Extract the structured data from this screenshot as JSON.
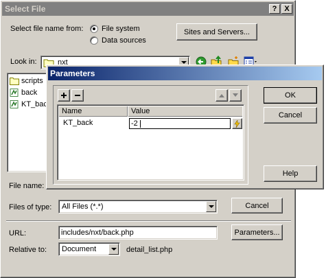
{
  "select_dialog": {
    "title": "Select File",
    "help_btn": "?",
    "close_btn": "X",
    "select_from_label": "Select file name from:",
    "radio_file_system": "File system",
    "radio_data_sources": "Data sources",
    "sites_button": "Sites and Servers...",
    "look_in_label": "Look in:",
    "look_in_value": "nxt",
    "files": [
      {
        "name": "scripts",
        "icon": "folder-icon"
      },
      {
        "name": "back",
        "icon": "dreamweaver-file-icon"
      },
      {
        "name": "KT_back",
        "icon": "dreamweaver-file-icon"
      }
    ],
    "file_name_label": "File name:",
    "files_of_type_label": "Files of type:",
    "files_of_type_value": "All Files (*.*)",
    "cancel_button": "Cancel",
    "url_label": "URL:",
    "url_value": "includes/nxt/back.php",
    "parameters_button": "Parameters...",
    "relative_to_label": "Relative to:",
    "relative_to_value": "Document",
    "relative_file": "detail_list.php"
  },
  "parameters_dialog": {
    "title": "Parameters",
    "add_btn": "+",
    "remove_btn": "−",
    "col_name": "Name",
    "col_value": "Value",
    "rows": [
      {
        "name": "KT_back",
        "value": "-2"
      }
    ],
    "ok_button": "OK",
    "cancel_button": "Cancel",
    "help_button": "Help"
  },
  "colors": {
    "titlebar_inactive": "#808080",
    "titlebar_active_start": "#0a246a",
    "titlebar_active_end": "#a6caf0",
    "face": "#d4d0c8"
  }
}
